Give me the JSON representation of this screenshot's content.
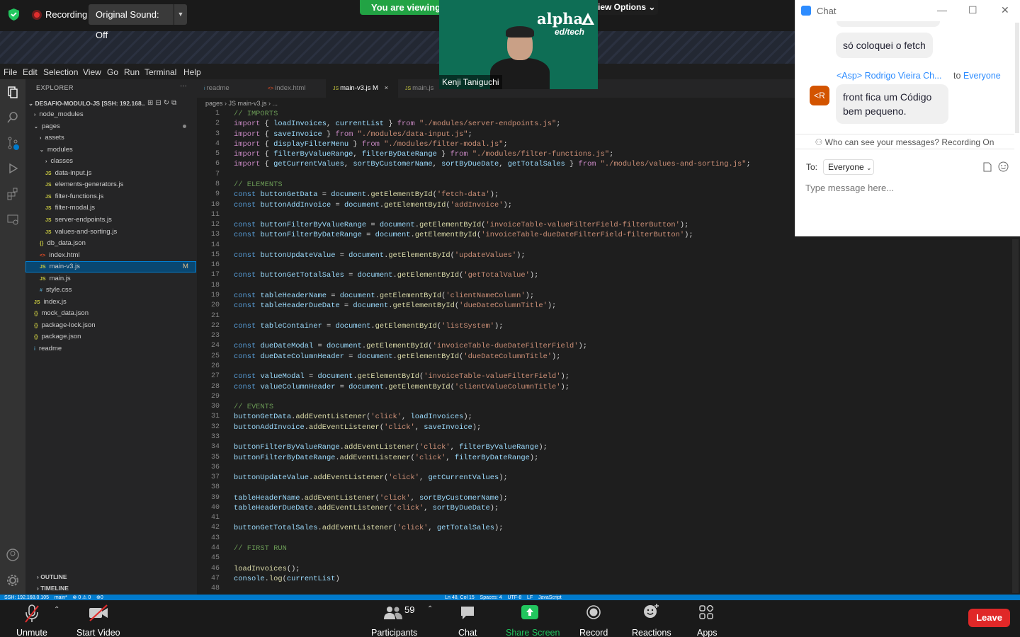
{
  "zoom_top": {
    "recording_label": "Recording",
    "original_sound_label": "Original Sound: Off",
    "viewing_label": "You are viewing",
    "view_options_label": "iew Options ⌄"
  },
  "video": {
    "participant_name": "Kenji Taniguchi",
    "logo_text": "alpha",
    "logo_subtext": "ed/tech"
  },
  "vscode": {
    "menu": [
      "File",
      "Edit",
      "Selection",
      "View",
      "Go",
      "Run",
      "Terminal",
      "Help"
    ],
    "explorer_title": "EXPLORER",
    "explorer_more": "···",
    "workspace": "DESAFIO-MODULO-JS [SSH: 192.168...",
    "tree": [
      {
        "label": "node_modules",
        "icon": "›",
        "depth": 1
      },
      {
        "label": "pages",
        "icon": "⌄",
        "depth": 1
      },
      {
        "label": "assets",
        "icon": "›",
        "depth": 2
      },
      {
        "label": "modules",
        "icon": "⌄",
        "depth": 2
      },
      {
        "label": "classes",
        "icon": "›",
        "depth": 3
      },
      {
        "label": "data-input.js",
        "icon": "JS",
        "depth": 3
      },
      {
        "label": "elements-generators.js",
        "icon": "JS",
        "depth": 3
      },
      {
        "label": "filter-functions.js",
        "icon": "JS",
        "depth": 3
      },
      {
        "label": "filter-modal.js",
        "icon": "JS",
        "depth": 3
      },
      {
        "label": "server-endpoints.js",
        "icon": "JS",
        "depth": 3
      },
      {
        "label": "values-and-sorting.js",
        "icon": "JS",
        "depth": 3
      },
      {
        "label": "db_data.json",
        "icon": "{}",
        "depth": 2
      },
      {
        "label": "index.html",
        "icon": "<>",
        "depth": 2
      },
      {
        "label": "main-v3.js",
        "icon": "JS",
        "depth": 2,
        "badge": "M"
      },
      {
        "label": "main.js",
        "icon": "JS",
        "depth": 2
      },
      {
        "label": "style.css",
        "icon": "#",
        "depth": 2
      },
      {
        "label": "index.js",
        "icon": "JS",
        "depth": 1
      },
      {
        "label": "mock_data.json",
        "icon": "{}",
        "depth": 1
      },
      {
        "label": "package-lock.json",
        "icon": "{}",
        "depth": 1
      },
      {
        "label": "package.json",
        "icon": "{}",
        "depth": 1
      },
      {
        "label": "readme",
        "icon": "i",
        "depth": 1
      }
    ],
    "tabs": [
      {
        "label": "readme",
        "icon": "i"
      },
      {
        "label": "index.html",
        "icon": "<>"
      },
      {
        "label": "main-v3.js M",
        "icon": "JS",
        "active": true,
        "close": "×"
      },
      {
        "label": "main.js",
        "icon": "JS"
      }
    ],
    "breadcrumb": "pages › JS main-v3.js › ...",
    "outline_label": "OUTLINE",
    "timeline_label": "TIMELINE",
    "status_text": "SSH: 192.168.0.105    main*    ⊗ 0 ⚠ 0    ⊕0                                                                                                                                                                                                                                                        Ln 48, Col 15    Spaces: 4    UTF-8    LF    JavaScript",
    "code": [
      "// IMPORTS",
      "import { loadInvoices, currentList } from \"./modules/server-endpoints.js\";",
      "import { saveInvoice } from \"./modules/data-input.js\";",
      "import { displayFilterMenu } from \"./modules/filter-modal.js\";",
      "import { filterByValueRange, filterByDateRange } from \"./modules/filter-functions.js\";",
      "import { getCurrentValues, sortByCustomerName, sortByDueDate, getTotalSales } from \"./modules/values-and-sorting.js\";",
      "",
      "// ELEMENTS",
      "const buttonGetData = document.getElementById('fetch-data');",
      "const buttonAddInvoice = document.getElementById('addInvoice');",
      "",
      "const buttonFilterByValueRange = document.getElementById('invoiceTable-valueFilterField-filterButton');",
      "const buttonFilterByDateRange = document.getElementById('invoiceTable-dueDateFilterField-filterButton');",
      "",
      "const buttonUpdateValue = document.getElementById('updateValues');",
      "",
      "const buttonGetTotalSales = document.getElementById('getTotalValue');",
      "",
      "const tableHeaderName = document.getElementById('clientNameColumn');",
      "const tableHeaderDueDate = document.getElementById('dueDateColumnTitle');",
      "",
      "const tableContainer = document.getElementById('listSystem');",
      "",
      "const dueDateModal = document.getElementById('invoiceTable-dueDateFilterField');",
      "const dueDateColumnHeader = document.getElementById('dueDateColumnTitle');",
      "",
      "const valueModal = document.getElementById('invoiceTable-valueFilterField');",
      "const valueColumnHeader = document.getElementById('clientValueColumnTitle');",
      "",
      "// EVENTS",
      "buttonGetData.addEventListener('click', loadInvoices);",
      "buttonAddInvoice.addEventListener('click', saveInvoice);",
      "",
      "buttonFilterByValueRange.addEventListener('click', filterByValueRange);",
      "buttonFilterByDateRange.addEventListener('click', filterByDateRange);",
      "",
      "buttonUpdateValue.addEventListener('click', getCurrentValues);",
      "",
      "tableHeaderName.addEventListener('click', sortByCustomerName);",
      "tableHeaderDueDate.addEventListener('click', sortByDueDate);",
      "",
      "buttonGetTotalSales.addEventListener('click', getTotalSales);",
      "",
      "// FIRST RUN",
      "",
      "loadInvoices();",
      "console.log(currentList)",
      ""
    ]
  },
  "chat": {
    "title": "Chat",
    "minimize": "—",
    "maximize": "☐",
    "close": "✕",
    "message1": "só coloquei o fetch",
    "sender": "<Asp> Rodrigo Vieira Ch...",
    "to_text": "to",
    "to_target": "Everyone",
    "avatar_initials": "<R",
    "message2": "front fica um Código bem pequeno.",
    "who_can_see": "Who can see your messages? Recording On",
    "to_label": "To:",
    "to_select": "Everyone",
    "input_placeholder": "Type message here..."
  },
  "zoom_bottom": {
    "unmute": "Unmute",
    "start_video": "Start Video",
    "participants": "Participants",
    "participants_count": "59",
    "chat": "Chat",
    "share_screen": "Share Screen",
    "record": "Record",
    "reactions": "Reactions",
    "apps": "Apps",
    "leave": "Leave"
  },
  "colors": {
    "share_green": "#22c55e",
    "leave_red": "#e02828",
    "vscode_blue": "#007acc",
    "chat_blue": "#2d8cff"
  }
}
